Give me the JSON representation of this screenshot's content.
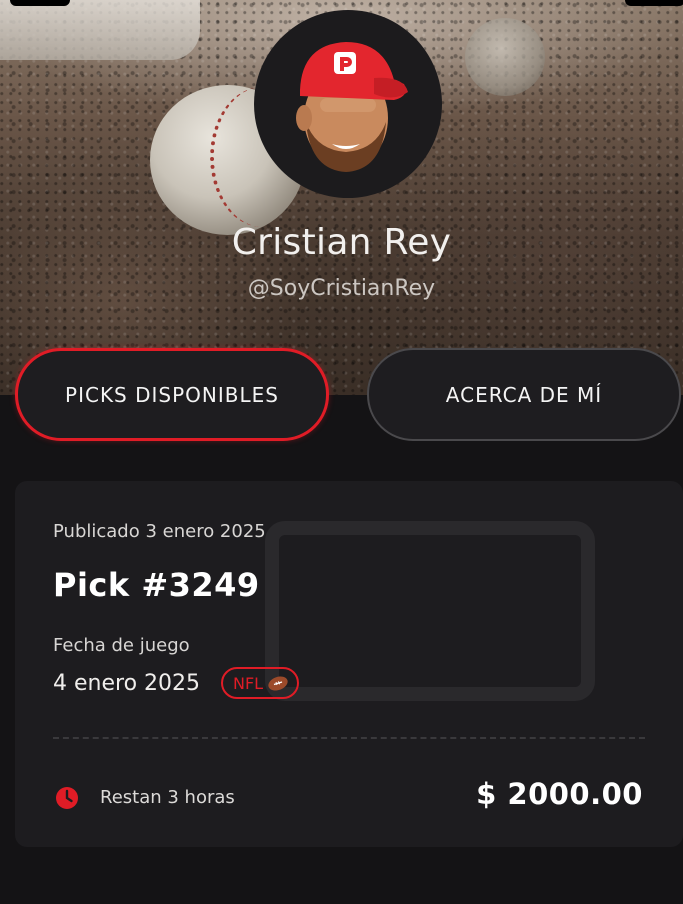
{
  "profile": {
    "name": "Cristian Rey",
    "handle": "@SoyCristianRey",
    "avatar_icon": "cartoon-avatar-red-cap"
  },
  "tabs": [
    {
      "label": "PICKS DISPONIBLES",
      "active": true
    },
    {
      "label": "ACERCA DE MÍ",
      "active": false
    }
  ],
  "pick_card": {
    "published": "Publicado 3 enero 2025",
    "title": "Pick #3249",
    "game_date_label": "Fecha de juego",
    "game_date": "4 enero 2025",
    "league": "NFL",
    "league_icon": "football-icon",
    "time_remaining": "Restan 3 horas",
    "time_icon": "clock-icon",
    "price": "$ 2000.00"
  },
  "colors": {
    "accent": "#e01c26",
    "background": "#141315",
    "card": "#1d1c1f"
  }
}
